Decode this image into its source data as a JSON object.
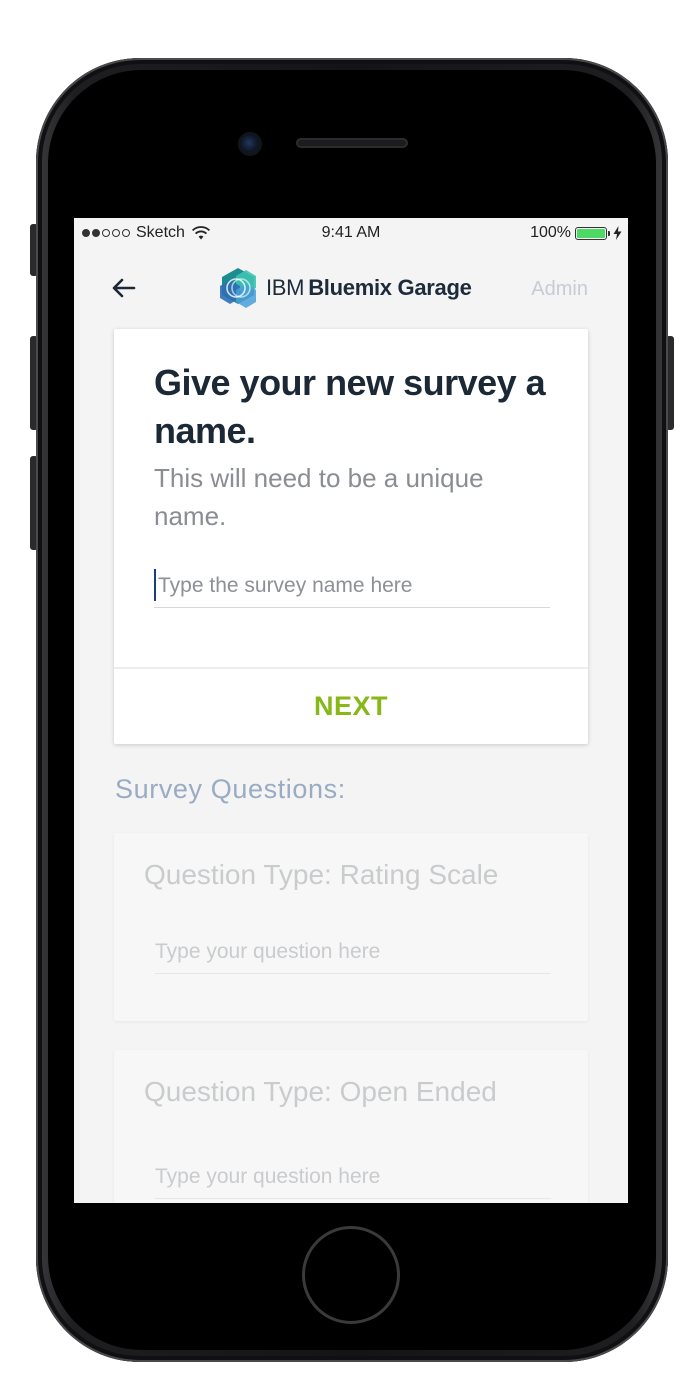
{
  "status_bar": {
    "carrier": "Sketch",
    "time": "9:41 AM",
    "battery_percent": "100%",
    "battery_level": 1.0,
    "signal_bars_filled": 2,
    "signal_bars_total": 5
  },
  "nav": {
    "brand_ibm": "IBM",
    "brand_name": "Bluemix Garage",
    "admin_label": "Admin",
    "back_icon": "back-arrow-icon"
  },
  "survey_name_card": {
    "heading": "Give your new survey a name.",
    "subtext": "This will need to be a unique name.",
    "input_placeholder": "Type the survey name here",
    "input_value": "",
    "next_label": "NEXT"
  },
  "survey_questions": {
    "section_title": "Survey Questions:",
    "questions": [
      {
        "type_label": "Question Type: Rating Scale",
        "placeholder": "Type your question here"
      },
      {
        "type_label": "Question Type: Open Ended",
        "placeholder": "Type your question here"
      }
    ]
  },
  "colors": {
    "accent_green": "#86b817",
    "heading_dark": "#1b2836",
    "section_blue": "#9aabc2",
    "battery_green": "#4cd964"
  }
}
